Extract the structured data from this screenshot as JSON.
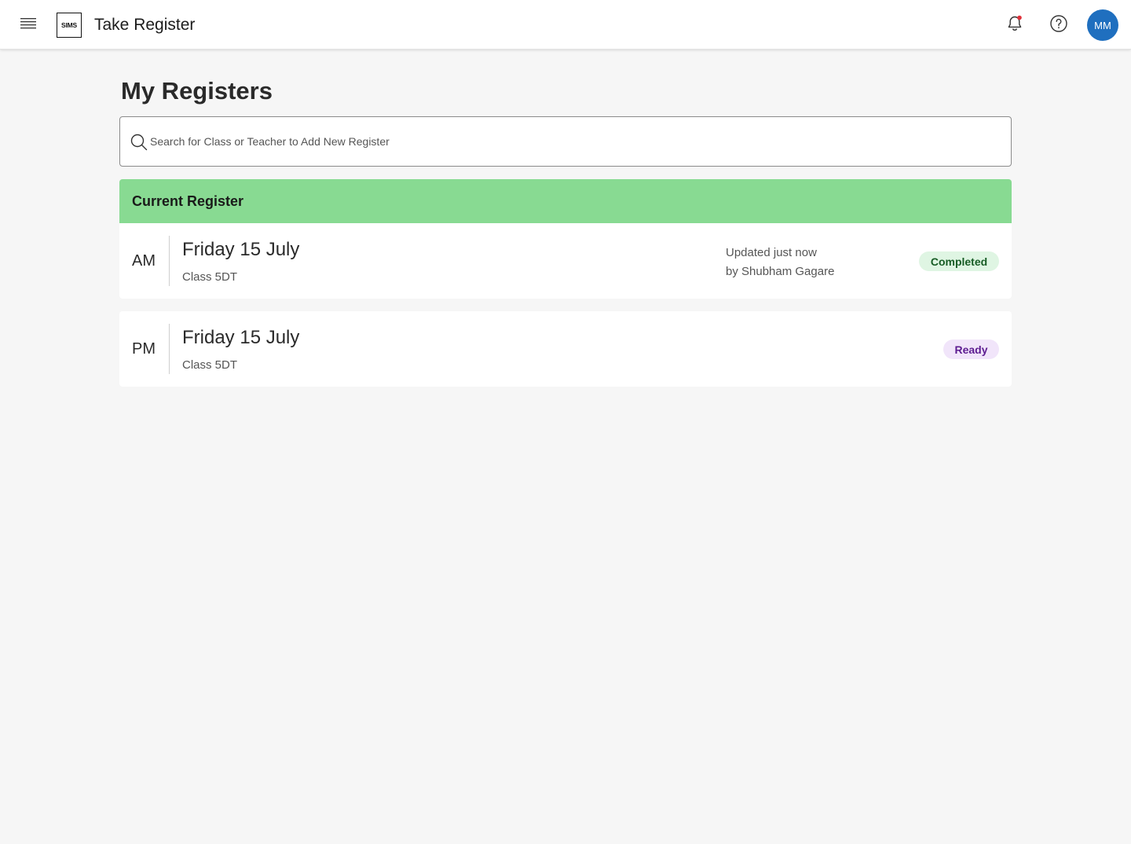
{
  "header": {
    "logo_text": "SIMS",
    "app_title": "Take Register",
    "avatar_initials": "MM",
    "notification_dot_color": "#e0303a",
    "avatar_color": "#1f6fbf"
  },
  "page": {
    "title": "My Registers"
  },
  "search": {
    "placeholder": "Search for Class or Teacher to Add New Register",
    "value": ""
  },
  "current_register": {
    "heading": "Current Register",
    "heading_color": "#88da92",
    "registers": [
      {
        "session": "AM",
        "date": "Friday 15 July",
        "class": "Class 5DT",
        "updated_line1": "Updated just now",
        "updated_line2": "by Shubham Gagare",
        "status": "Completed"
      },
      {
        "session": "PM",
        "date": "Friday 15 July",
        "class": "Class 5DT",
        "status": "Ready"
      }
    ]
  }
}
